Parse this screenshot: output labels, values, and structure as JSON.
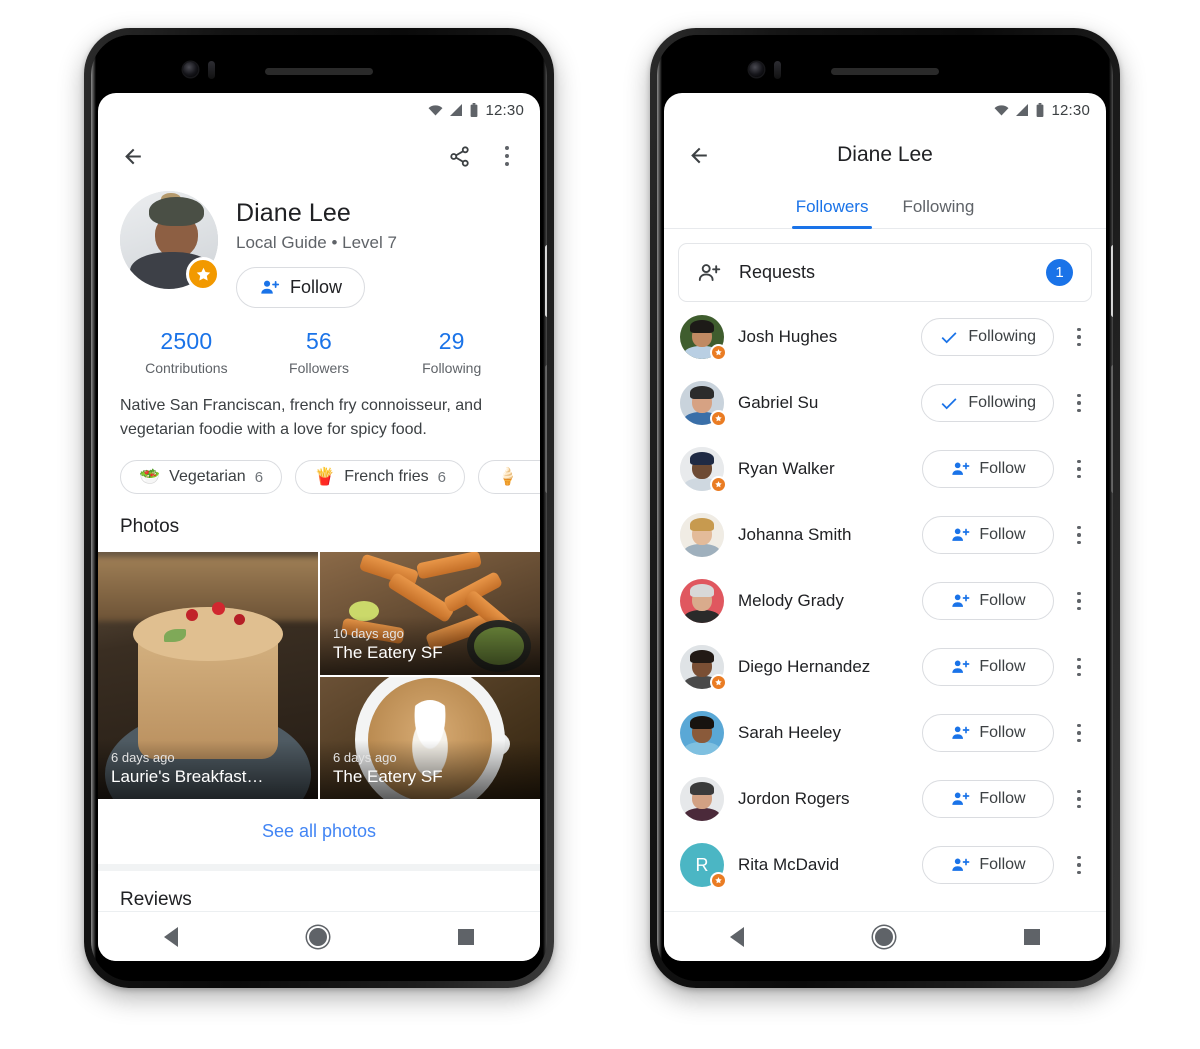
{
  "statusbar": {
    "time": "12:30"
  },
  "phone1": {
    "topbar": {
      "back": "back-arrow",
      "share": "share",
      "more": "more-options"
    },
    "profile": {
      "name": "Diane Lee",
      "subtitle": "Local Guide • Level 7",
      "follow_button": "Follow",
      "badge": "local-guide-star"
    },
    "stats": [
      {
        "value": "2500",
        "label": "Contributions"
      },
      {
        "value": "56",
        "label": "Followers"
      },
      {
        "value": "29",
        "label": "Following"
      }
    ],
    "bio": "Native San Franciscan, french fry connoisseur, and vegetarian foodie with a love for spicy food.",
    "chips": [
      {
        "emoji": "🥗",
        "label": "Vegetarian",
        "count": "6"
      },
      {
        "emoji": "🍟",
        "label": "French fries",
        "count": "6"
      },
      {
        "emoji": "🍦",
        "label": "",
        "count": ""
      }
    ],
    "photos_section_title": "Photos",
    "photos": [
      {
        "date": "6 days ago",
        "place": "Laurie's Breakfast…"
      },
      {
        "date": "10 days ago",
        "place": "The Eatery SF"
      },
      {
        "date": "6 days ago",
        "place": "The Eatery SF"
      }
    ],
    "see_all_photos": "See all photos",
    "reviews_section_title": "Reviews"
  },
  "phone2": {
    "title": "Diane Lee",
    "tabs": [
      {
        "label": "Followers",
        "active": true
      },
      {
        "label": "Following",
        "active": false
      }
    ],
    "requests": {
      "label": "Requests",
      "count": "1"
    },
    "followers": [
      {
        "name": "Josh Hughes",
        "action": "Following",
        "state": "following",
        "guide_badge": true,
        "initial": ""
      },
      {
        "name": "Gabriel Su",
        "action": "Following",
        "state": "following",
        "guide_badge": true,
        "initial": ""
      },
      {
        "name": "Ryan Walker",
        "action": "Follow",
        "state": "follow",
        "guide_badge": true,
        "initial": ""
      },
      {
        "name": "Johanna Smith",
        "action": "Follow",
        "state": "follow",
        "guide_badge": false,
        "initial": ""
      },
      {
        "name": "Melody Grady",
        "action": "Follow",
        "state": "follow",
        "guide_badge": false,
        "initial": ""
      },
      {
        "name": "Diego Hernandez",
        "action": "Follow",
        "state": "follow",
        "guide_badge": true,
        "initial": ""
      },
      {
        "name": "Sarah Heeley",
        "action": "Follow",
        "state": "follow",
        "guide_badge": false,
        "initial": ""
      },
      {
        "name": "Jordon Rogers",
        "action": "Follow",
        "state": "follow",
        "guide_badge": false,
        "initial": ""
      },
      {
        "name": "Rita McDavid",
        "action": "Follow",
        "state": "follow",
        "guide_badge": true,
        "initial": "R"
      }
    ]
  },
  "colors": {
    "accent_blue": "#1A73E8",
    "link_blue": "#4285F4",
    "badge_orange": "#F29900",
    "guide_orange": "#EA7C23",
    "text_primary": "#202124",
    "text_secondary": "#5f6368",
    "avatar_teal": "#4BB6C4"
  }
}
